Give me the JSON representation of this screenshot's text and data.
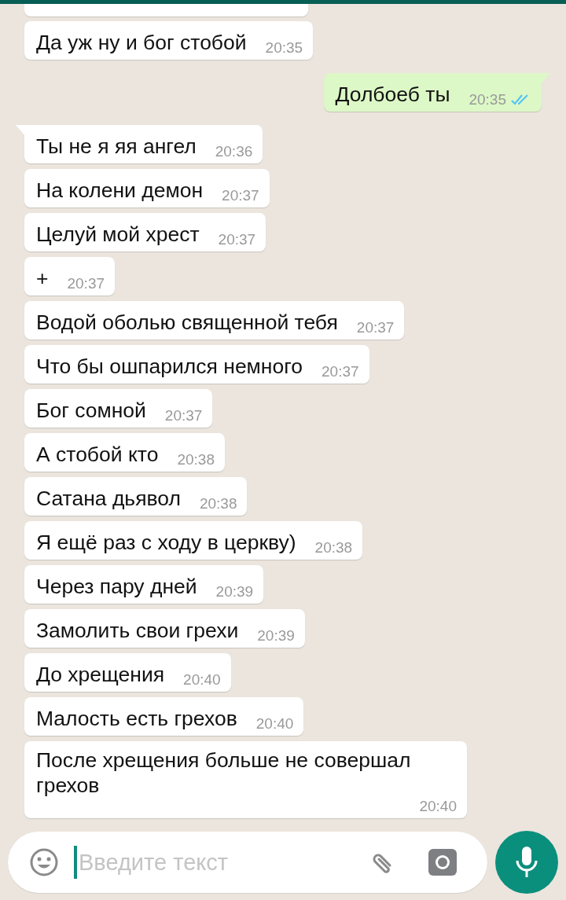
{
  "messages": [
    {
      "kind": "incoming",
      "tail": false,
      "text": "Да уж ну и бог стобой",
      "time": "20:35"
    },
    {
      "kind": "outgoing",
      "tail": true,
      "text": "Долбоеб ты",
      "time": "20:35",
      "read": true
    },
    {
      "kind": "incoming",
      "tail": true,
      "text": "Ты не я яя ангел",
      "time": "20:36"
    },
    {
      "kind": "incoming",
      "tail": false,
      "text": "На колени демон",
      "time": "20:37"
    },
    {
      "kind": "incoming",
      "tail": false,
      "text": "Целуй мой хрест",
      "time": "20:37"
    },
    {
      "kind": "incoming",
      "tail": false,
      "text": "+",
      "time": "20:37"
    },
    {
      "kind": "incoming",
      "tail": false,
      "text": "Водой оболью священной тебя",
      "time": "20:37"
    },
    {
      "kind": "incoming",
      "tail": false,
      "text": "Что бы ошпарился немного",
      "time": "20:37"
    },
    {
      "kind": "incoming",
      "tail": false,
      "text": "Бог сомной",
      "time": "20:37"
    },
    {
      "kind": "incoming",
      "tail": false,
      "text": "А стобой кто",
      "time": "20:38"
    },
    {
      "kind": "incoming",
      "tail": false,
      "text": "Сатана дьявол",
      "time": "20:38"
    },
    {
      "kind": "incoming",
      "tail": false,
      "text": "Я ещё раз с ходу в церкву)",
      "time": "20:38"
    },
    {
      "kind": "incoming",
      "tail": false,
      "text": "Через пару дней",
      "time": "20:39"
    },
    {
      "kind": "incoming",
      "tail": false,
      "text": "Замолить свои грехи",
      "time": "20:39"
    },
    {
      "kind": "incoming",
      "tail": false,
      "text": "До хрещения",
      "time": "20:40"
    },
    {
      "kind": "incoming",
      "tail": false,
      "text": "Малость есть грехов",
      "time": "20:40"
    },
    {
      "kind": "incoming",
      "tail": false,
      "text": "После хрещения больше не совершал грехов",
      "time": "20:40"
    }
  ],
  "composer": {
    "placeholder": "Введите текст"
  }
}
